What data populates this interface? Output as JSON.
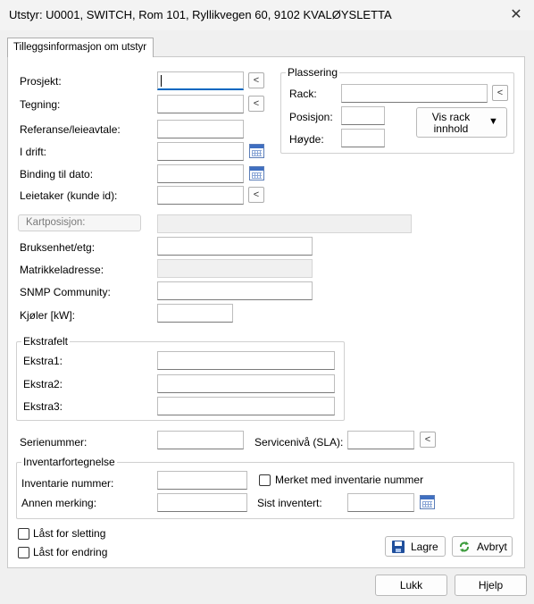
{
  "window": {
    "title": "Utstyr: U0001, SWITCH, Rom 101, Ryllikvegen 60, 9102 KVALØYSLETTA",
    "close_glyph": "✕"
  },
  "tab": {
    "label": "Tilleggsinformasjon om utstyr"
  },
  "fields": {
    "prosjekt": {
      "label": "Prosjekt:",
      "value": ""
    },
    "tegning": {
      "label": "Tegning:",
      "value": ""
    },
    "referanse": {
      "label": "Referanse/leieavtale:",
      "value": ""
    },
    "i_drift": {
      "label": "I drift:",
      "value": ""
    },
    "binding": {
      "label": "Binding til dato:",
      "value": ""
    },
    "leietaker": {
      "label": "Leietaker (kunde id):",
      "value": ""
    },
    "kartposisjon": {
      "label": "Kartposisjon:",
      "value": ""
    },
    "bruksenhet": {
      "label": "Bruksenhet/etg:",
      "value": ""
    },
    "matrikkeladresse": {
      "label": "Matrikkeladresse:",
      "value": ""
    },
    "snmp": {
      "label": "SNMP Community:",
      "value": ""
    },
    "kjoler": {
      "label": "Kjøler [kW]:",
      "value": ""
    },
    "serienummer": {
      "label": "Serienummer:",
      "value": ""
    },
    "servicenivaa": {
      "label": "Servicenivå (SLA):",
      "value": ""
    }
  },
  "lookup_glyph": "<",
  "plassering": {
    "legend": "Plassering",
    "rack_label": "Rack:",
    "posisjon_label": "Posisjon:",
    "hoyde_label": "Høyde:",
    "vis_rack_line1": "Vis rack",
    "vis_rack_line2": "innhold",
    "dropdown_glyph": "▼"
  },
  "ekstrafelt": {
    "legend": "Ekstrafelt",
    "ekstra1": "Ekstra1:",
    "ekstra2": "Ekstra2:",
    "ekstra3": "Ekstra3:"
  },
  "inventar": {
    "legend": "Inventarfortegnelse",
    "nummer_label": "Inventarie nummer:",
    "annen_label": "Annen merking:",
    "merket_label": "Merket med inventarie nummer",
    "merket_checked": false,
    "sist_label": "Sist inventert:"
  },
  "locks": {
    "sletting_label": "Låst for sletting",
    "sletting_checked": false,
    "endring_label": "Låst for endring",
    "endring_checked": false
  },
  "buttons": {
    "lagre": "Lagre",
    "avbryt": "Avbryt",
    "lukk": "Lukk",
    "hjelp": "Hjelp"
  },
  "icons": {
    "calendar": "calendar-icon",
    "save": "save-icon",
    "refresh": "refresh-icon",
    "close": "close-icon"
  },
  "colors": {
    "accent": "#0067c0",
    "panel_bg": "#ffffff",
    "window_bg": "#f0f0f0"
  }
}
